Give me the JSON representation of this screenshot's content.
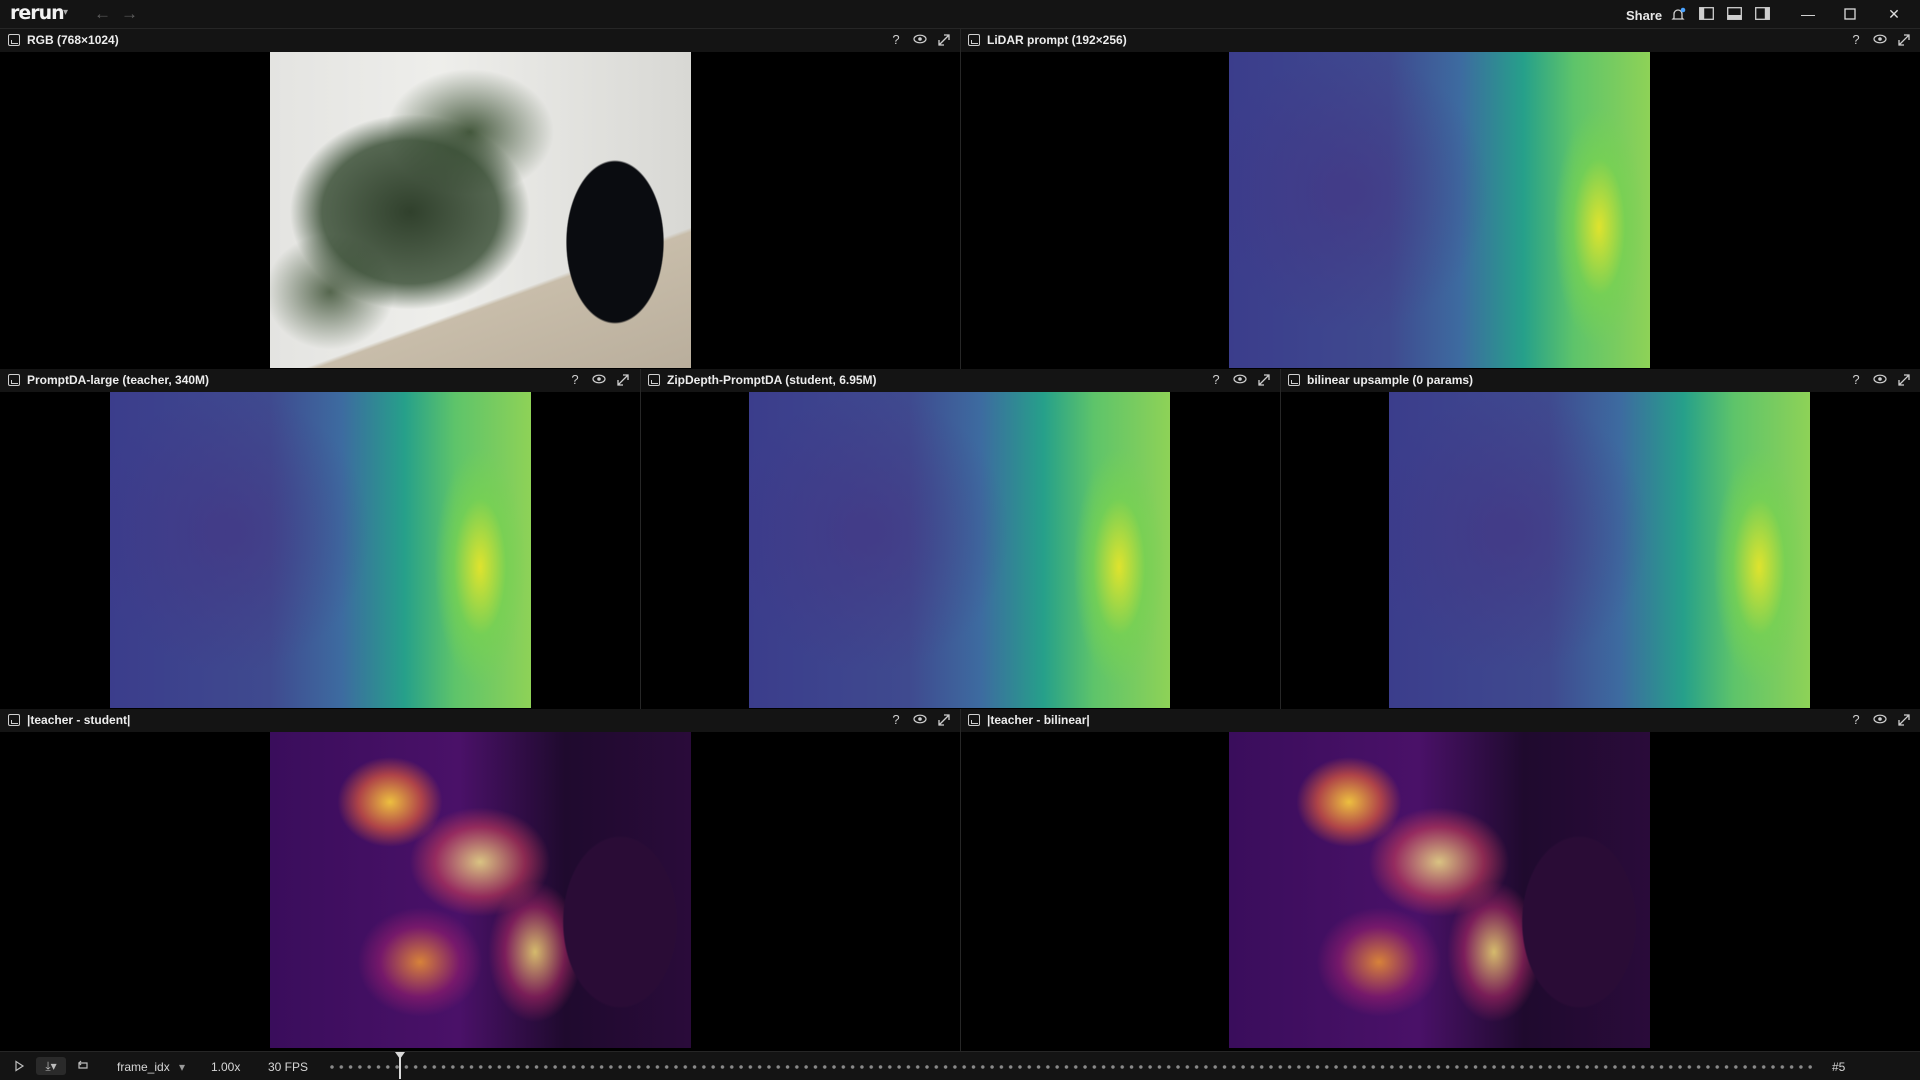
{
  "app": {
    "logo": "rerun",
    "share_label": "Share"
  },
  "panels": {
    "rgb": {
      "title": "RGB (768×1024)"
    },
    "lidar": {
      "title": "LiDAR prompt (192×256)"
    },
    "teacher": {
      "title": "PromptDA-large (teacher, 340M)"
    },
    "student": {
      "title": "ZipDepth-PromptDA (student, 6.95M)"
    },
    "bilinear": {
      "title": "bilinear upsample (0 params)"
    },
    "diff_ts": {
      "title": "|teacher - student|"
    },
    "diff_tb": {
      "title": "|teacher - bilinear|"
    }
  },
  "header_buttons": {
    "help": "?"
  },
  "timeline": {
    "timeline_name": "frame_idx",
    "speed": "1.00x",
    "fps": "30 FPS",
    "current_frame": "#5"
  },
  "colors": {
    "background": "#000000",
    "bar": "#141414",
    "divider": "#262626",
    "text": "#ededed"
  }
}
